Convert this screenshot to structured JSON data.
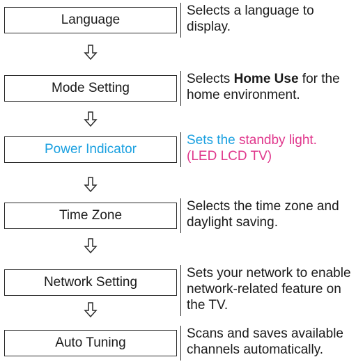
{
  "steps": [
    {
      "label": "Language",
      "desc": "Selects a language to display."
    },
    {
      "label": "Mode Setting",
      "desc_pre": "Selects ",
      "desc_bold": "Home Use",
      "desc_post": " for the home environment."
    },
    {
      "label": "Power Indicator",
      "desc_pre": "Sets the ",
      "desc_highlight": "standby light.",
      "desc_sub": "(LED LCD TV)"
    },
    {
      "label": "Time Zone",
      "desc": "Selects the time zone and daylight saving."
    },
    {
      "label": "Network Setting",
      "desc": "Sets your network to enable network-related feature on the TV."
    },
    {
      "label": "Auto Tuning",
      "desc": "Scans and saves available channels automatically."
    }
  ],
  "colors": {
    "power_label": "#1aa0e0",
    "standby_highlight": "#e0378c",
    "border": "#2a2a2a"
  },
  "arrow_icon": "down-outline-arrow-icon"
}
